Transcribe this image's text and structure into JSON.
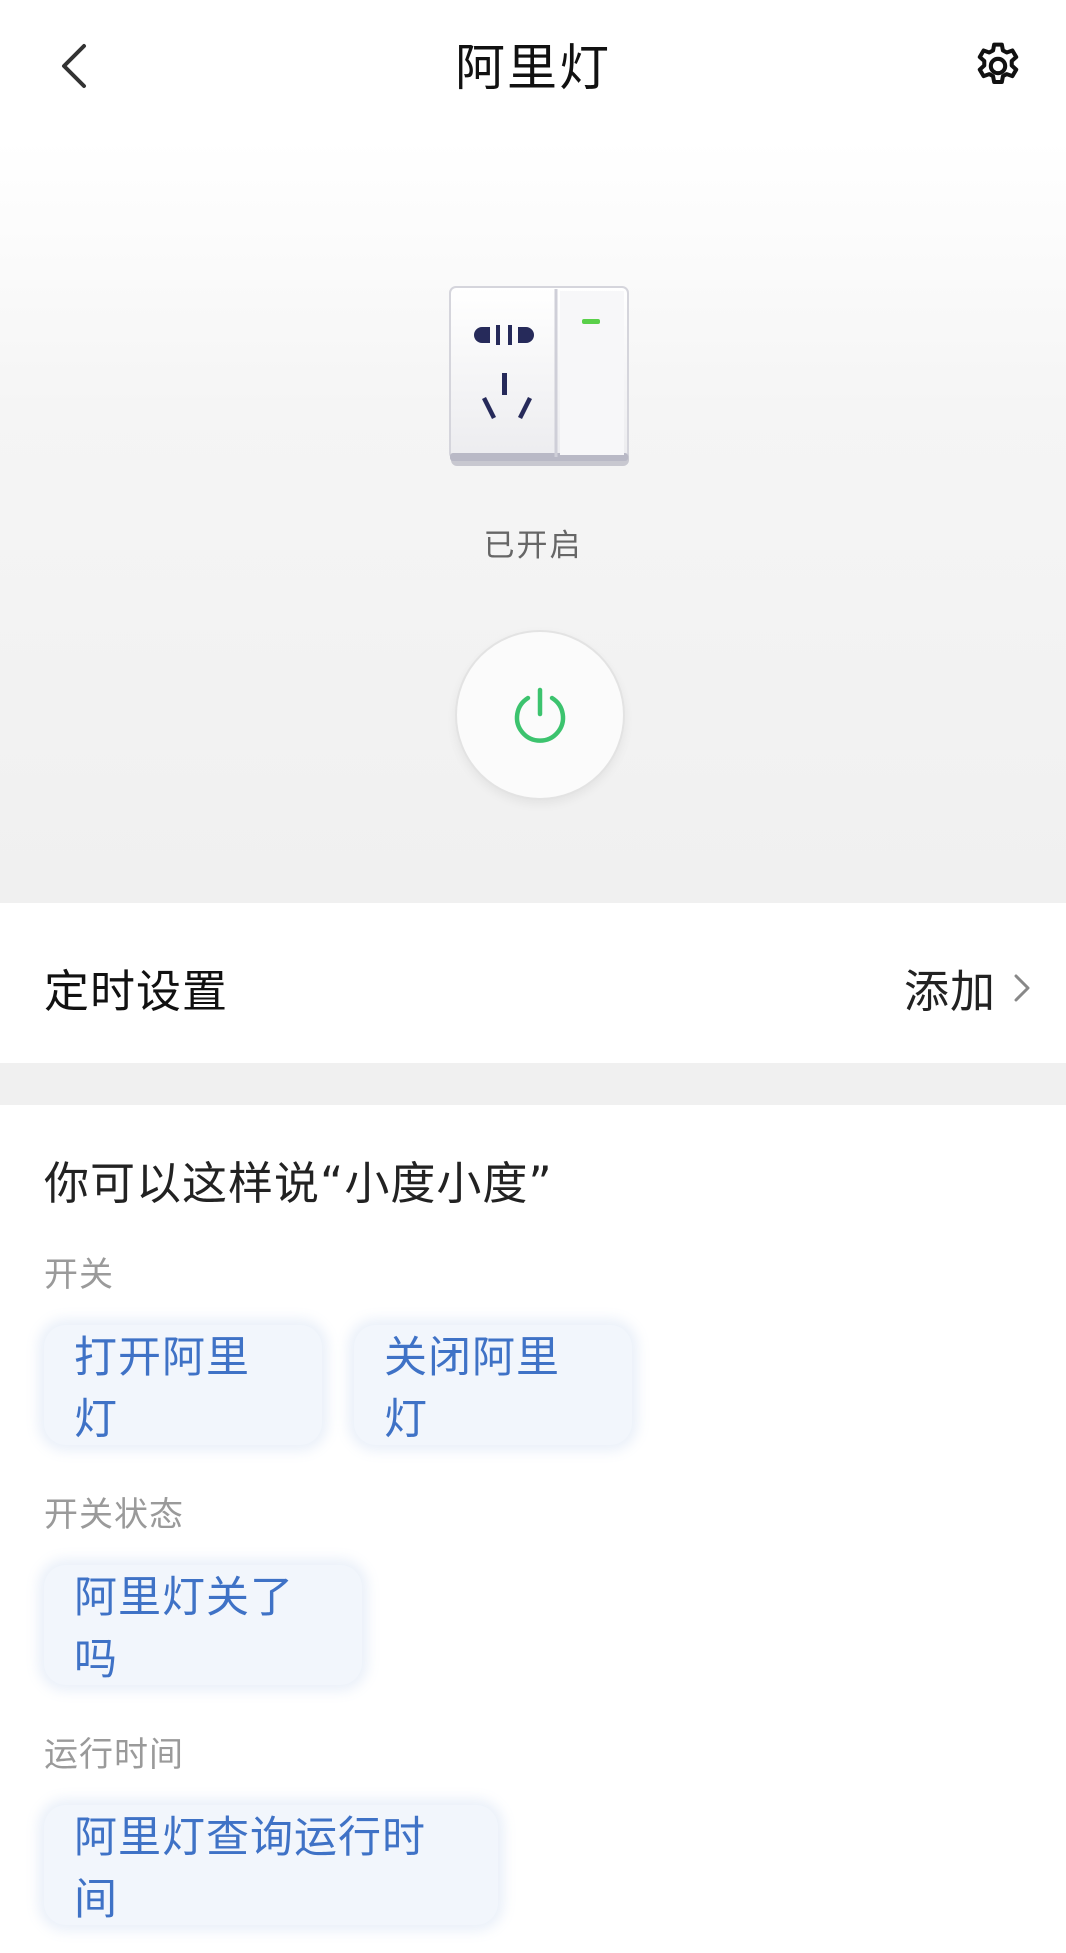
{
  "header": {
    "title": "阿里灯",
    "back_icon": "chevron-left-icon",
    "settings_icon": "gear-icon"
  },
  "device": {
    "status": "已开启",
    "power_icon": "power-icon",
    "is_on": true,
    "power_color": "#3cc36e"
  },
  "timer": {
    "label": "定时设置",
    "action_label": "添加",
    "action_icon": "chevron-right-icon"
  },
  "voice": {
    "title": "你可以这样说“小度小度”",
    "groups": [
      {
        "label": "开关",
        "commands": [
          "打开阿里灯",
          "关闭阿里灯"
        ]
      },
      {
        "label": "开关状态",
        "commands": [
          "阿里灯关了吗"
        ]
      },
      {
        "label": "运行时间",
        "commands": [
          "阿里灯查询运行时间"
        ]
      }
    ]
  },
  "colors": {
    "chip_text": "#3f72c6",
    "chip_bg": "#f2f6fc",
    "indicator_green": "#5ad04a"
  }
}
